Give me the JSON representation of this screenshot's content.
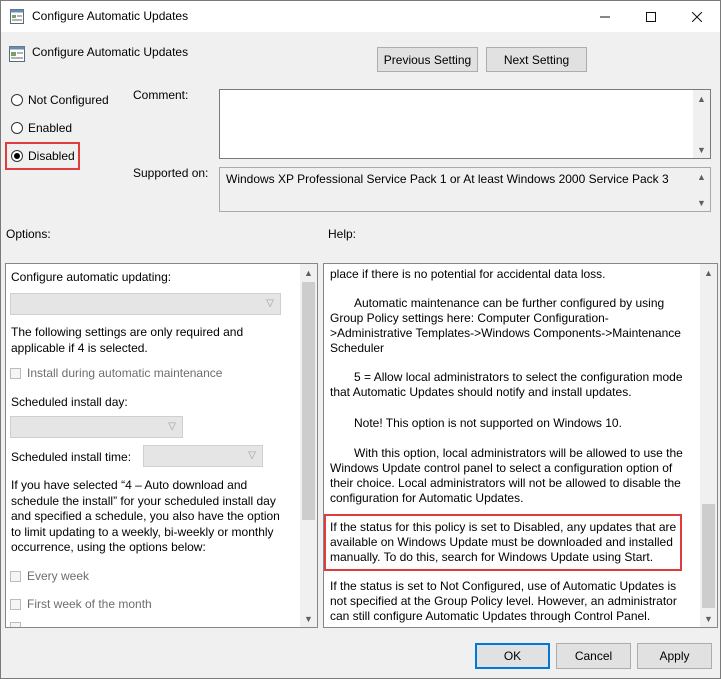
{
  "window": {
    "title": "Configure Automatic Updates",
    "policy_name": "Configure Automatic Updates",
    "icons": [
      "policy-icon",
      "minimize-icon",
      "maximize-icon",
      "close-icon"
    ]
  },
  "nav": {
    "previous_label": "Previous Setting",
    "next_label": "Next Setting"
  },
  "state": {
    "options": [
      {
        "label": "Not Configured",
        "checked": false
      },
      {
        "label": "Enabled",
        "checked": false
      },
      {
        "label": "Disabled",
        "checked": true
      }
    ]
  },
  "comment": {
    "label": "Comment:",
    "value": ""
  },
  "supported": {
    "label": "Supported on:",
    "value": "Windows XP Professional Service Pack 1 or At least Windows 2000 Service Pack 3"
  },
  "options_panel": {
    "header": "Options:",
    "configure_label": "Configure automatic updating:",
    "note": "The following settings are only required and applicable if 4 is selected.",
    "install_maint_label": "Install during automatic maintenance",
    "day_label": "Scheduled install day:",
    "time_label": "Scheduled install time:",
    "schedule_note": "If you have selected “4 – Auto download and schedule the install” for your scheduled install day and specified a schedule, you also have the option to limit updating to a weekly, bi-weekly or monthly occurrence, using the options below:",
    "every_week_label": "Every week",
    "first_week_label": "First week of the month"
  },
  "help_panel": {
    "header": "Help:",
    "paragraphs": [
      "place if there is no potential for accidental data loss.",
      "Automatic maintenance can be further configured by using Group Policy settings here: Computer Configuration->Administrative Templates->Windows Components->Maintenance Scheduler",
      "5 = Allow local administrators to select the configuration mode that Automatic Updates should notify and install updates.",
      "Note! This option is not supported on Windows 10.",
      "With this option, local administrators will be allowed to use the Windows Update control panel to select a configuration option of their choice. Local administrators will not be allowed to disable the configuration for Automatic Updates.",
      "If the status for this policy is set to Disabled, any updates that are available on Windows Update must be downloaded and installed manually. To do this, search for Windows Update using Start.",
      "If the status is set to Not Configured, use of Automatic Updates is not specified at the Group Policy level. However, an administrator can still configure Automatic Updates through Control Panel."
    ]
  },
  "footer": {
    "ok_label": "OK",
    "cancel_label": "Cancel",
    "apply_label": "Apply"
  },
  "colors": {
    "highlight": "#e03c3c",
    "default_button_border": "#0078d7"
  }
}
